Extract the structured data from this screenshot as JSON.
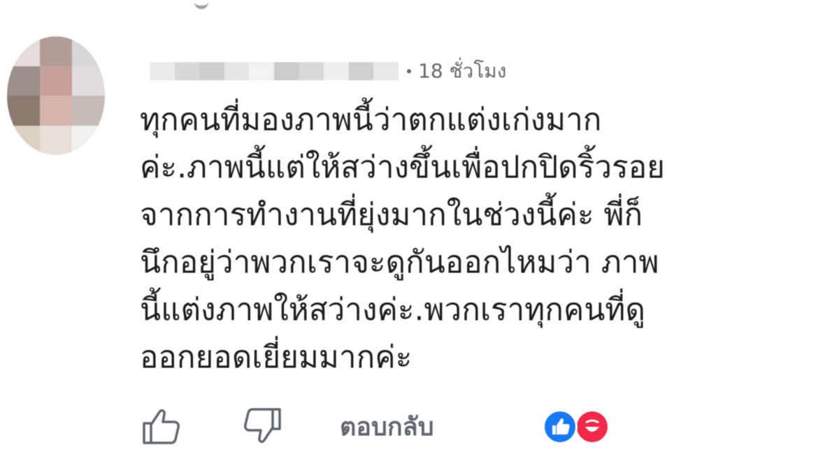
{
  "comment": {
    "time": "18 ชั่วโมง",
    "lines": [
      "ทุกคนที่มองภาพนี้ว่าตกแต่งเก่งมาก",
      "ค่ะ.ภาพนี้แต่ให้สว่างขึ้นเพื่อปกปิดริ้วรอย",
      "จากการทำงานที่ยุ่งมากในช่วงนี้ค่ะ พี่ก็",
      "นึกอยู่ว่าพวกเราจะดูกันออกไหมว่า ภาพ",
      "นี้แต่งภาพให้สว่างค่ะ.พวกเราทุกคนที่ดู",
      "ออกยอดเยี่ยมมากค่ะ"
    ]
  },
  "actions": {
    "like_icon": "thumbs-up-icon",
    "dislike_icon": "thumbs-down-icon",
    "reply_label": "ตอบกลับ",
    "reaction_icons": [
      "like-reaction-icon",
      "haha-reaction-icon"
    ]
  },
  "colors": {
    "text": "#1c1e21",
    "meta": "#65676b",
    "like_blue": "#1877f2",
    "haha_red": "#f0284a"
  }
}
